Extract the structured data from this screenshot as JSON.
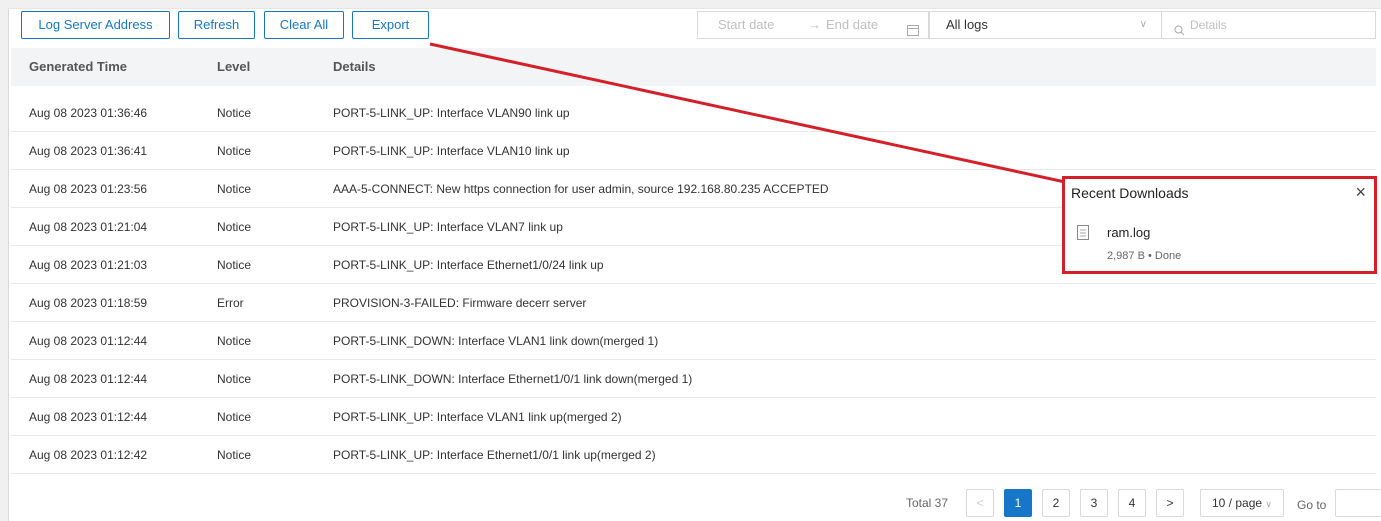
{
  "toolbar": {
    "log_server_label": "Log Server Address",
    "refresh_label": "Refresh",
    "clear_label": "Clear All",
    "export_label": "Export",
    "start_date_placeholder": "Start date",
    "range_separator": "→",
    "end_date_placeholder": "End date",
    "filter_value": "All logs",
    "search_placeholder": "Details"
  },
  "table": {
    "headers": {
      "time": "Generated Time",
      "level": "Level",
      "details": "Details"
    },
    "rows": [
      {
        "time": "Aug 08 2023 01:36:46",
        "level": "Notice",
        "details": "PORT-5-LINK_UP: Interface VLAN90 link up"
      },
      {
        "time": "Aug 08 2023 01:36:41",
        "level": "Notice",
        "details": "PORT-5-LINK_UP: Interface VLAN10 link up"
      },
      {
        "time": "Aug 08 2023 01:23:56",
        "level": "Notice",
        "details": "AAA-5-CONNECT: New https connection for user admin, source 192.168.80.235 ACCEPTED"
      },
      {
        "time": "Aug 08 2023 01:21:04",
        "level": "Notice",
        "details": "PORT-5-LINK_UP: Interface VLAN7 link up"
      },
      {
        "time": "Aug 08 2023 01:21:03",
        "level": "Notice",
        "details": "PORT-5-LINK_UP: Interface Ethernet1/0/24 link up"
      },
      {
        "time": "Aug 08 2023 01:18:59",
        "level": "Error",
        "details": "PROVISION-3-FAILED: Firmware decerr server"
      },
      {
        "time": "Aug 08 2023 01:12:44",
        "level": "Notice",
        "details": "PORT-5-LINK_DOWN: Interface VLAN1 link down(merged 1)"
      },
      {
        "time": "Aug 08 2023 01:12:44",
        "level": "Notice",
        "details": "PORT-5-LINK_DOWN: Interface Ethernet1/0/1 link down(merged 1)"
      },
      {
        "time": "Aug 08 2023 01:12:44",
        "level": "Notice",
        "details": "PORT-5-LINK_UP: Interface VLAN1 link up(merged 2)"
      },
      {
        "time": "Aug 08 2023 01:12:42",
        "level": "Notice",
        "details": "PORT-5-LINK_UP: Interface Ethernet1/0/1 link up(merged 2)"
      }
    ]
  },
  "pagination": {
    "total": "Total 37",
    "prev": "<",
    "pages": [
      "1",
      "2",
      "3",
      "4"
    ],
    "current": "1",
    "next": ">",
    "page_size": "10 / page",
    "goto": "Go to"
  },
  "downloads": {
    "title": "Recent Downloads",
    "close": "×",
    "file_name": "ram.log",
    "file_status": "2,987 B • Done"
  },
  "colors": {
    "accent": "#1677c9",
    "highlight": "#d32029"
  }
}
